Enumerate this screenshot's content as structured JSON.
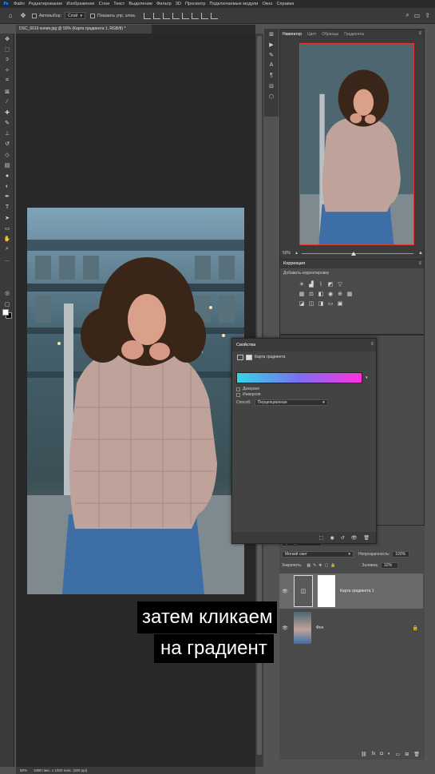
{
  "menubar": {
    "logo": "Ps",
    "items": [
      "Файл",
      "Редактирование",
      "Изображение",
      "Слои",
      "Текст",
      "Выделение",
      "Фильтр",
      "3D",
      "Просмотр",
      "Подключаемые модули",
      "Окно",
      "Справка"
    ]
  },
  "options": {
    "autoselect_label": "Автовыбор:",
    "autoselect_value": "Слой",
    "show_transform_label": "Показать упр. элем."
  },
  "document": {
    "tab_title": "DSC_6619 копия.jpg @ 50% (Карта градиента 1, RGB/8) *"
  },
  "panels": {
    "nav_tabs": [
      "Навигатор",
      "Цвет",
      "Образцы",
      "Градиенты"
    ],
    "nav_zoom": "50%",
    "adjustments_title": "Коррекция",
    "adjustments_add": "Добавить корректировку"
  },
  "properties": {
    "title": "Свойства",
    "layer_type": "Карта градиента",
    "gradient_colors": [
      "#34d6e6",
      "#7c6ff0",
      "#ff2fe0"
    ],
    "dither": "Дизеринг",
    "reverse": "Инверсия",
    "method_label": "Способ:",
    "method_value": "Перцепционная"
  },
  "layers": {
    "kind": "Q Вид",
    "blend_mode": "Мягкий свет",
    "opacity_label": "Непрозрачность:",
    "opacity_value": "100%",
    "lock_label": "Закрепить:",
    "fill_label": "Заливка:",
    "fill_value": "32%",
    "items": [
      {
        "name": "Карта градиента 1",
        "selected": true
      },
      {
        "name": "Фон",
        "selected": false
      }
    ]
  },
  "status": {
    "zoom": "50%",
    "info": "1080 пикс. x 1920 пикс. (300 ppi)"
  },
  "subtitles": {
    "line1": "затем кликаем",
    "line2": "на градиент"
  }
}
